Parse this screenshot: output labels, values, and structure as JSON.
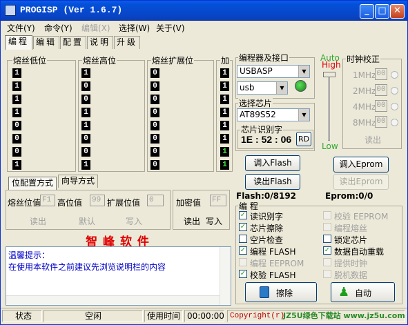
{
  "window": {
    "title": "PROGISP (Ver 1.6.7)"
  },
  "menu": [
    {
      "label": "文件(Y)",
      "disabled": false
    },
    {
      "label": "命令(Y)",
      "disabled": false
    },
    {
      "label": "编辑(X)",
      "disabled": true
    },
    {
      "label": "选择(W)",
      "disabled": false
    },
    {
      "label": "关于(V)",
      "disabled": false
    }
  ],
  "tabs": [
    "编程",
    "编辑",
    "配置",
    "说明",
    "升级"
  ],
  "fuses": {
    "low": {
      "title": "熔丝低位",
      "bits": [
        "1",
        "1",
        "1",
        "1",
        "0",
        "0",
        "0",
        "1"
      ]
    },
    "high": {
      "title": "熔丝高位",
      "bits": [
        "1",
        "0",
        "0",
        "1",
        "1",
        "0",
        "0",
        "1"
      ]
    },
    "ext": {
      "title": "熔丝扩展位",
      "bits": [
        "0",
        "0",
        "0",
        "0",
        "0",
        "0",
        "0",
        "0"
      ]
    },
    "lock": {
      "title": "加",
      "bits": [
        "1",
        "1",
        "1",
        "1",
        "1",
        "1",
        "1",
        "1"
      ]
    }
  },
  "fuse_tabs": {
    "bit_mode": "位配置方式",
    "wizard_mode": "向导方式"
  },
  "fuse_values": {
    "low_label": "熔丝位值",
    "low": "F1",
    "high_label": "高位值",
    "high": "99",
    "ext_label": "扩展位值",
    "ext": "0",
    "read": "读出",
    "default": "默认",
    "write": "写入",
    "enc_label": "加密值",
    "enc": "FF",
    "enc_read": "读出",
    "enc_write": "写入"
  },
  "brand": "智 峰 软 件",
  "tips": {
    "title": "温馨提示：",
    "text": "在使用本软件之前建议先浏览说明栏的内容"
  },
  "programmer": {
    "group": "编程器及接口",
    "device": "USBASP",
    "port": "usb"
  },
  "level": {
    "auto": "Auto",
    "high": "High",
    "low": "Low"
  },
  "clock": {
    "group": "时钟校正",
    "items": [
      {
        "label": "1MHz",
        "value": "00"
      },
      {
        "label": "2MHz",
        "value": "00"
      },
      {
        "label": "4MHz",
        "value": "00"
      },
      {
        "label": "8MHz",
        "value": "00"
      }
    ],
    "read": "读出"
  },
  "chip": {
    "group": "选择芯片",
    "name": "AT89S52",
    "id_group": "芯片识别字",
    "id": "1E : 52 : 06",
    "rd": "RD"
  },
  "buttons": {
    "load_flash": "调入Flash",
    "save_flash": "读出Flash",
    "load_eprom": "调入Eprom",
    "save_eprom": "读出Eprom",
    "erase": "擦除",
    "auto": "自动"
  },
  "sizes": {
    "flash": "Flash:0/8192",
    "eprom": "Eprom:0/0"
  },
  "program": {
    "group": "编 程",
    "options": [
      {
        "label": "读识别字",
        "checked": true,
        "disabled": false
      },
      {
        "label": "芯片擦除",
        "checked": true,
        "disabled": false
      },
      {
        "label": "空片检查",
        "checked": false,
        "disabled": false
      },
      {
        "label": "编程 FLASH",
        "checked": true,
        "disabled": false
      },
      {
        "label": "编程 EEPROM",
        "checked": false,
        "disabled": true
      },
      {
        "label": "校验 FLASH",
        "checked": true,
        "disabled": false
      },
      {
        "label": "校验 EEPROM",
        "checked": false,
        "disabled": true
      },
      {
        "label": "编程熔丝",
        "checked": false,
        "disabled": true
      },
      {
        "label": "锁定芯片",
        "checked": false,
        "disabled": false
      },
      {
        "label": "数据自动重载",
        "checked": true,
        "disabled": false
      },
      {
        "label": "提供时钟",
        "checked": false,
        "disabled": true
      },
      {
        "label": "脱机数据",
        "checked": false,
        "disabled": true
      }
    ]
  },
  "status": {
    "label": "状态",
    "state": "空闲",
    "time_label": "使用时间",
    "time": "00:00:00",
    "copyright": "Copyright(r)",
    "watermark": "JZ5U绿色下载站 www.jz5u.com"
  },
  "colors": {
    "title_bar": "#0a5ce6",
    "brand_red": "#e00000",
    "tips_blue": "#0000c8",
    "led_green": "#1ca01c",
    "auto_green": "#30a830",
    "high_red": "#e00000"
  }
}
